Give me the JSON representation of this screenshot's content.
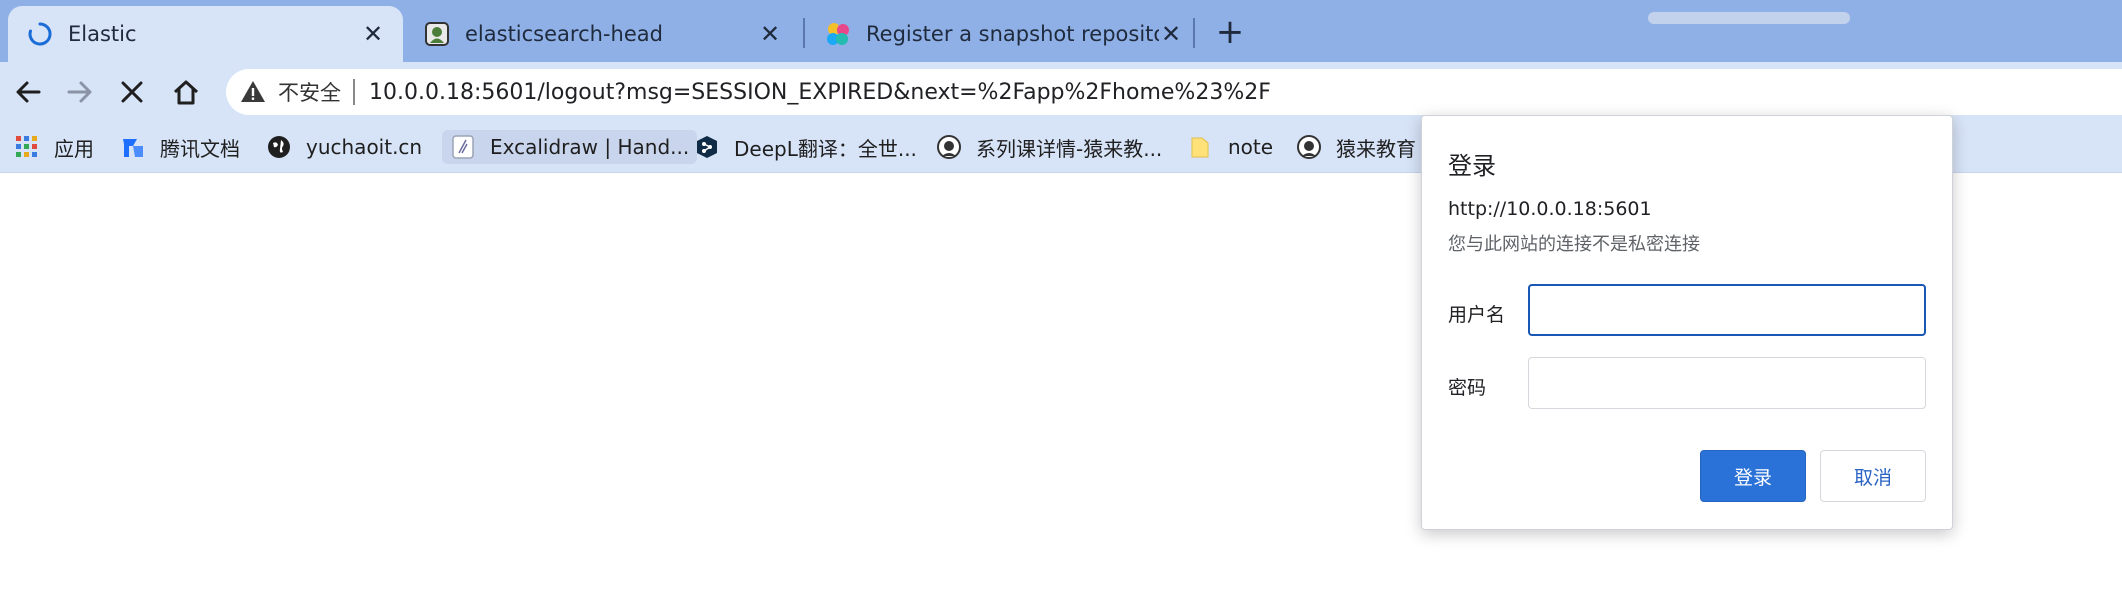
{
  "tabs": [
    {
      "title": "Elastic",
      "active": true,
      "loading": true
    },
    {
      "title": "elasticsearch-head",
      "active": false
    },
    {
      "title": "Register a snapshot repository",
      "active": false
    }
  ],
  "toolbar": {
    "security_label": "不安全",
    "url": "10.0.0.18:5601/logout?msg=SESSION_EXPIRED&next=%2Fapp%2Fhome%23%2F"
  },
  "bookmarks": [
    {
      "label": "应用",
      "icon": "apps-grid-icon"
    },
    {
      "label": "腾讯文档",
      "icon": "tencent-docs-icon"
    },
    {
      "label": "yuchaoit.cn",
      "icon": "globe-icon"
    },
    {
      "label": "Excalidraw | Hand...",
      "icon": "excalidraw-icon"
    },
    {
      "label": "DeepL翻译：全世...",
      "icon": "deepl-icon"
    },
    {
      "label": "系列课详情-猿来教...",
      "icon": "yuanlai-icon"
    },
    {
      "label": "note",
      "icon": "folder-icon"
    },
    {
      "label": "猿来教育",
      "icon": "yuanlai-icon"
    }
  ],
  "dialog": {
    "title": "登录",
    "host": "http://10.0.0.18:5601",
    "warning": "您与此网站的连接不是私密连接",
    "username_label": "用户名",
    "username_value": "",
    "password_label": "密码",
    "password_value": "",
    "login_button": "登录",
    "cancel_button": "取消"
  },
  "colors": {
    "tabstrip_bg": "#8fb0e6",
    "toolbar_bg": "#d7e3f7",
    "primary_button": "#2a72d8",
    "focus_border": "#1a56b3"
  }
}
